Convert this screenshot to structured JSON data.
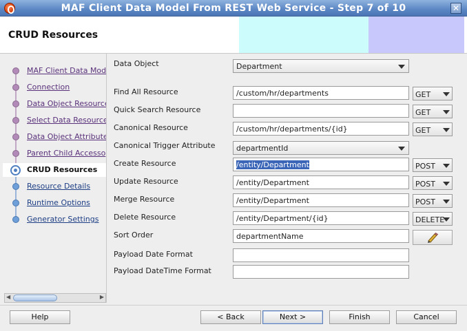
{
  "window": {
    "title": "MAF Client Data Model From REST Web Service - Step 7 of 10",
    "close": "✕"
  },
  "header": {
    "title": "CRUD Resources"
  },
  "nav": {
    "items": [
      {
        "label": "MAF Client Data Mode"
      },
      {
        "label": "Connection"
      },
      {
        "label": "Data Object Resource"
      },
      {
        "label": "Select Data Resources"
      },
      {
        "label": "Data Object Attribute"
      },
      {
        "label": "Parent Child Accesso"
      },
      {
        "label": "CRUD Resources"
      },
      {
        "label": "Resource Details"
      },
      {
        "label": "Runtime Options"
      },
      {
        "label": "Generator Settings"
      }
    ]
  },
  "form": {
    "data_object": {
      "label": "Data Object",
      "value": "Department"
    },
    "find_all": {
      "label": "Find All Resource",
      "value": "/custom/hr/departments",
      "method": "GET"
    },
    "quick_search": {
      "label": "Quick Search Resource",
      "value": "",
      "method": "GET"
    },
    "canonical": {
      "label": "Canonical Resource",
      "value": "/custom/hr/departments/{id}",
      "method": "GET"
    },
    "canonical_trigger": {
      "label": "Canonical Trigger Attribute",
      "value": "departmentId"
    },
    "create": {
      "label": "Create Resource",
      "value": "/entity/Department",
      "method": "POST"
    },
    "update": {
      "label": "Update Resource",
      "value": "/entity/Department",
      "method": "POST"
    },
    "merge": {
      "label": "Merge Resource",
      "value": "/entity/Department",
      "method": "POST"
    },
    "delete": {
      "label": "Delete Resource",
      "value": "/entity/Department/{id}",
      "method": "DELETE"
    },
    "sort_order": {
      "label": "Sort Order",
      "value": "departmentName"
    },
    "payload_date": {
      "label": "Payload Date Format",
      "value": ""
    },
    "payload_datetime": {
      "label": "Payload DateTime Format",
      "value": ""
    }
  },
  "buttons": {
    "help": "Help",
    "back": "< Back",
    "next": "Next >",
    "finish": "Finish",
    "cancel": "Cancel"
  },
  "icons": {
    "edit": "pencil-icon",
    "app": "app-logo-icon"
  }
}
